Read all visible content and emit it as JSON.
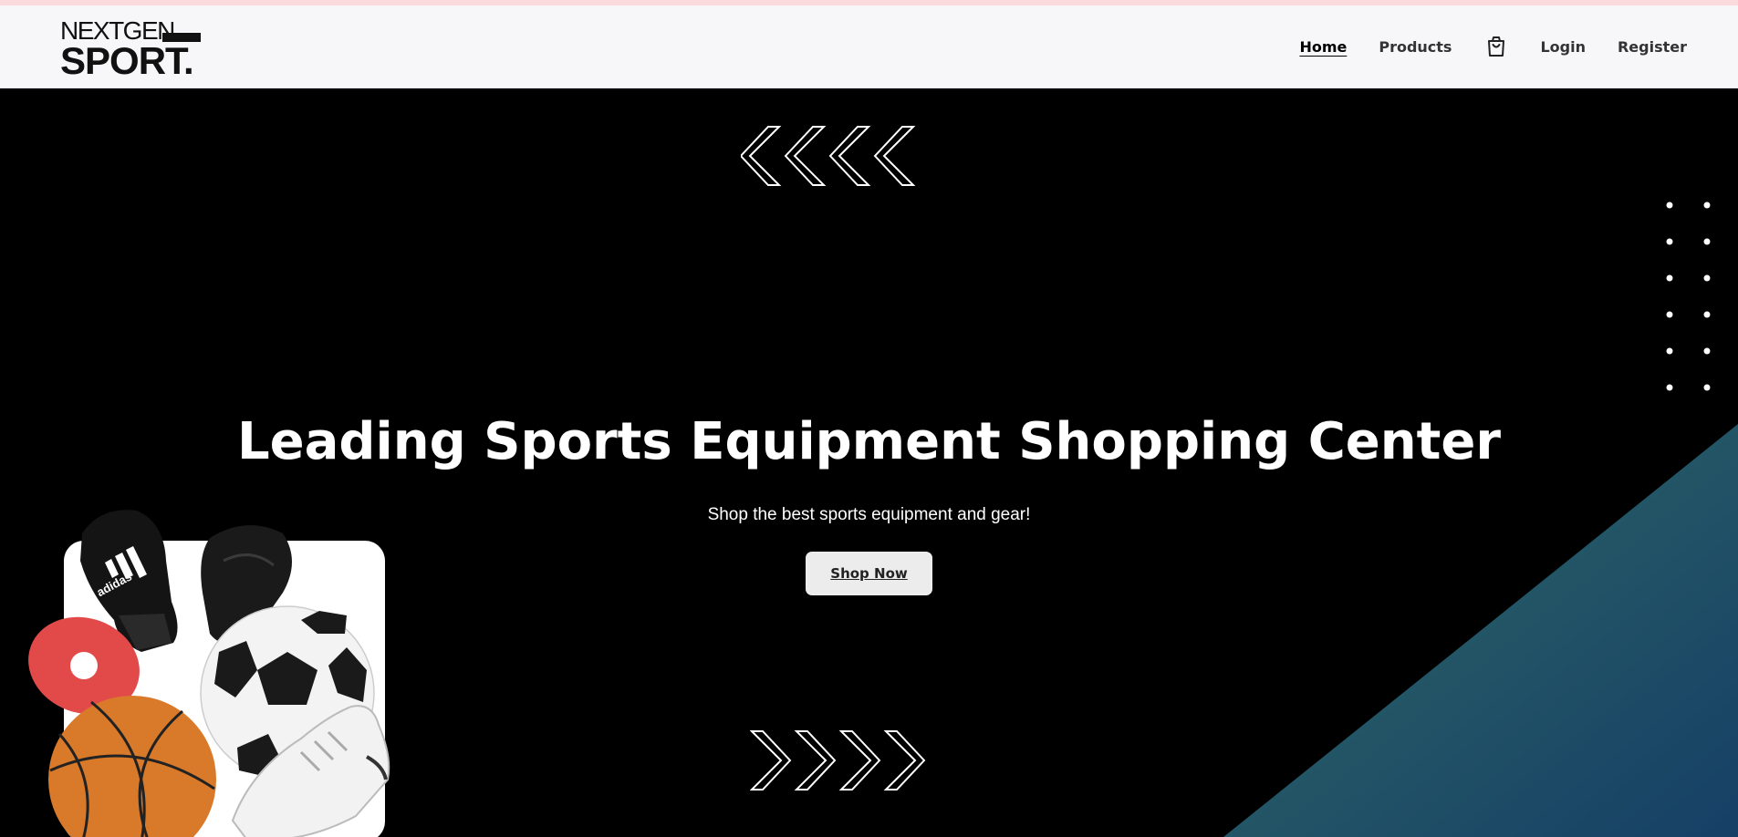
{
  "brand": {
    "logo_top": "NEXTGEN",
    "logo_bottom": "SPORT."
  },
  "nav": {
    "links": [
      "Home",
      "Products",
      "Login",
      "Register"
    ],
    "active": "Home",
    "cart_icon": "shopping-bag-icon"
  },
  "hero": {
    "title": "Leading Sports Equipment Shopping Center",
    "subtitle": "Shop the best sports equipment and gear!",
    "cta_label": "Shop Now",
    "ball_brand": "adidas"
  },
  "colors": {
    "hero_bg": "#000000",
    "nav_bg": "#f7f7fa",
    "top_strip": "#fadadd",
    "gradient_start": "#2f6b66",
    "gradient_end": "#163f66",
    "button_bg": "#ececec"
  }
}
